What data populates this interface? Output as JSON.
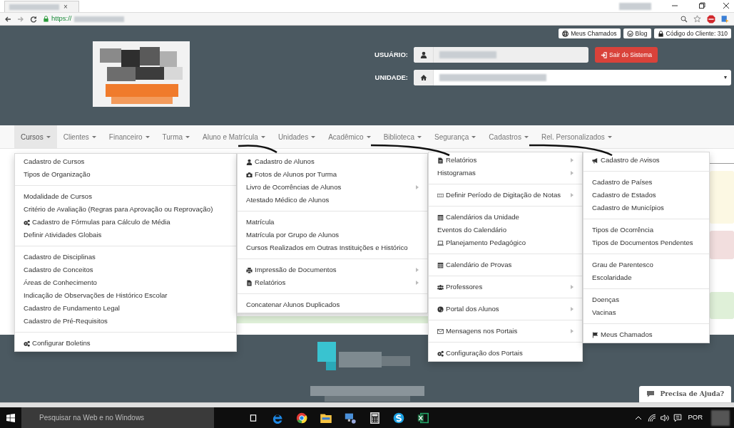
{
  "browser": {
    "tab_close": "×",
    "url": "https://"
  },
  "header": {
    "top_links": [
      {
        "label": "Meus Chamados",
        "kind": "lifebuoy"
      },
      {
        "label": "Blog",
        "kind": "wordpress"
      },
      {
        "label": "Código do Cliente: 310",
        "kind": "lock"
      }
    ],
    "user_label": "USUÁRIO:",
    "unit_label": "UNIDADE:",
    "logout": "Sair do Sistema",
    "unit_caret": "▾"
  },
  "nav": {
    "items": [
      {
        "label": "Cursos",
        "selected": true
      },
      {
        "label": "Clientes",
        "selected": false
      },
      {
        "label": "Financeiro",
        "selected": false
      },
      {
        "label": "Turma",
        "selected": false
      },
      {
        "label": "Aluno e Matrícula",
        "selected": false
      },
      {
        "label": "Unidades",
        "selected": false
      },
      {
        "label": "Acadêmico",
        "selected": false
      },
      {
        "label": "Biblioteca",
        "selected": false
      },
      {
        "label": "Segurança",
        "selected": false
      },
      {
        "label": "Cadastros",
        "selected": false
      },
      {
        "label": "Rel. Personalizados",
        "selected": false
      }
    ]
  },
  "menus": [
    {
      "groups": [
        [
          {
            "label": "Cadastro de Cursos",
            "kind": "text",
            "submenu": false
          },
          {
            "label": "Tipos de Organização",
            "kind": "text",
            "submenu": false
          }
        ],
        [
          {
            "label": "Modalidade de Cursos",
            "kind": "text",
            "submenu": false
          },
          {
            "label": "Critério de Avaliação (Regras para Aprovação ou Reprovação)",
            "kind": "text",
            "submenu": false
          },
          {
            "label": "Cadastro de Fórmulas para Cálculo de Média",
            "kind": "gears",
            "submenu": false
          },
          {
            "label": "Definir Atividades Globais",
            "kind": "text",
            "submenu": false
          }
        ],
        [
          {
            "label": "Cadastro de Disciplinas",
            "kind": "text",
            "submenu": false
          },
          {
            "label": "Cadastro de Conceitos",
            "kind": "text",
            "submenu": false
          },
          {
            "label": "Áreas de Conhecimento",
            "kind": "text",
            "submenu": false
          },
          {
            "label": "Indicação de Observações de Histórico Escolar",
            "kind": "text",
            "submenu": false
          },
          {
            "label": "Cadastro de Fundamento Legal",
            "kind": "text",
            "submenu": false
          },
          {
            "label": "Cadastro de Pré-Requisitos",
            "kind": "text",
            "submenu": false
          }
        ],
        [
          {
            "label": "Configurar Boletins",
            "kind": "gears",
            "submenu": false
          }
        ]
      ]
    },
    {
      "groups": [
        [
          {
            "label": "Cadastro de Alunos",
            "kind": "user",
            "submenu": false
          },
          {
            "label": "Fotos de Alunos por Turma",
            "kind": "camera",
            "submenu": false
          },
          {
            "label": "Livro de Ocorrências de Alunos",
            "kind": "text",
            "submenu": true
          },
          {
            "label": "Atestado Médico de Alunos",
            "kind": "text",
            "submenu": false
          }
        ],
        [
          {
            "label": "Matrícula",
            "kind": "text",
            "submenu": false
          },
          {
            "label": "Matrícula por Grupo de Alunos",
            "kind": "text",
            "submenu": false
          },
          {
            "label": "Cursos Realizados em Outras Instituições e Histórico",
            "kind": "text",
            "submenu": false
          }
        ],
        [
          {
            "label": "Impressão de Documentos",
            "kind": "print",
            "submenu": true
          },
          {
            "label": "Relatórios",
            "kind": "file",
            "submenu": true
          }
        ],
        [
          {
            "label": "Concatenar Alunos Duplicados",
            "kind": "text",
            "submenu": false
          }
        ]
      ]
    },
    {
      "groups": [
        [
          {
            "label": "Relatórios",
            "kind": "file",
            "submenu": true
          },
          {
            "label": "Histogramas",
            "kind": "text",
            "submenu": true
          }
        ],
        [
          {
            "label": "Definir Período de Digitação de Notas",
            "kind": "keyboard",
            "submenu": true
          }
        ],
        [
          {
            "label": "Calendários da Unidade",
            "kind": "calendar",
            "submenu": false
          },
          {
            "label": "Eventos do Calendário",
            "kind": "text",
            "submenu": false
          },
          {
            "label": "Planejamento Pedagógico",
            "kind": "laptop",
            "submenu": false
          }
        ],
        [
          {
            "label": "Calendário de Provas",
            "kind": "calendar",
            "submenu": false
          }
        ],
        [
          {
            "label": "Professores",
            "kind": "group",
            "submenu": true
          }
        ],
        [
          {
            "label": "Portal dos Alunos",
            "kind": "globe",
            "submenu": true
          }
        ],
        [
          {
            "label": "Mensagens nos Portais",
            "kind": "envelope",
            "submenu": true
          }
        ],
        [
          {
            "label": "Configuração dos Portais",
            "kind": "gears",
            "submenu": false
          }
        ]
      ]
    },
    {
      "groups": [
        [
          {
            "label": "Cadastro de Avisos",
            "kind": "bullhorn",
            "submenu": false
          }
        ],
        [
          {
            "label": "Cadastro de Países",
            "kind": "text",
            "submenu": false
          },
          {
            "label": "Cadastro de Estados",
            "kind": "text",
            "submenu": false
          },
          {
            "label": "Cadastro de Municípios",
            "kind": "text",
            "submenu": false
          }
        ],
        [
          {
            "label": "Tipos de Ocorrência",
            "kind": "text",
            "submenu": false
          },
          {
            "label": "Tipos de Documentos Pendentes",
            "kind": "text",
            "submenu": false
          }
        ],
        [
          {
            "label": "Grau de Parentesco",
            "kind": "text",
            "submenu": false
          },
          {
            "label": "Escolaridade",
            "kind": "text",
            "submenu": false
          }
        ],
        [
          {
            "label": "Doenças",
            "kind": "text",
            "submenu": false
          },
          {
            "label": "Vacinas",
            "kind": "text",
            "submenu": false
          }
        ],
        [
          {
            "label": "Meus Chamados",
            "kind": "flag",
            "submenu": false
          }
        ]
      ]
    }
  ],
  "help": {
    "label": "Precisa de Ajuda?"
  },
  "taskbar": {
    "search_placeholder": "Pesquisar na Web e no Windows",
    "language": "POR"
  }
}
